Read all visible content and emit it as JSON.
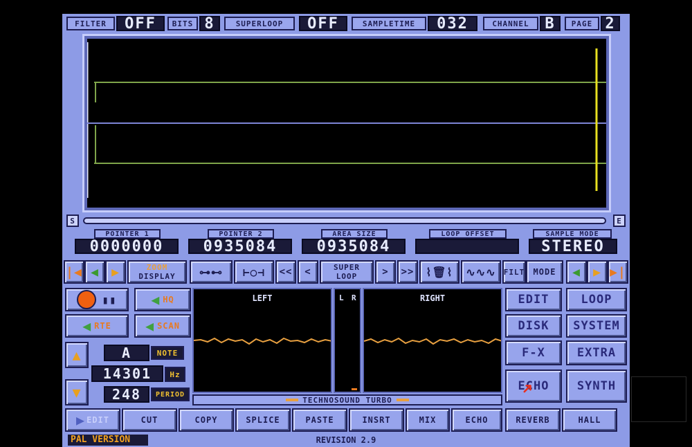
{
  "top_bar": {
    "filter_label": "FILTER",
    "filter_value": "OFF",
    "bits_label": "BITS",
    "bits_value": "8",
    "superloop_label": "SUPERLOOP",
    "superloop_value": "OFF",
    "sampletime_label": "SAMPLETIME",
    "sampletime_value": "032",
    "channel_label": "CHANNEL",
    "channel_value": "B",
    "page_label": "PAGE",
    "page_value": "2"
  },
  "scroll": {
    "start_label": "S",
    "end_label": "E"
  },
  "pointers": {
    "pointer1_label": "POINTER 1",
    "pointer1_value": "0000000",
    "pointer2_label": "POINTER 2",
    "pointer2_value": "0935084",
    "area_label": "AREA SIZE",
    "area_value": "0935084",
    "loop_label": "LOOP OFFSET",
    "loop_value": "",
    "mode_label": "SAMPLE MODE",
    "mode_value": "STEREO"
  },
  "toolbar": {
    "zoom_line1": "ZOOM",
    "zoom_line2": "DISPLAY",
    "rew_fast": "<<",
    "rew": "<",
    "superloop_line1": "SUPER",
    "superloop_line2": "LOOP",
    "fwd": ">",
    "fwd_fast": ">>",
    "filt": "FILT",
    "mode": "MODE"
  },
  "controls": {
    "hq_label": "HQ",
    "rte_label": "RTE",
    "scan_label": "SCAN",
    "note_value": "A",
    "note_label": "NOTE",
    "hz_value": "14301",
    "hz_label": "Hz",
    "period_value": "248",
    "period_label": "PERIOD"
  },
  "scopes": {
    "left_title": "LEFT",
    "right_title": "RIGHT",
    "l_label": "L",
    "r_label": "R",
    "banner": "TECHNOSOUND TURBO"
  },
  "menu": {
    "edit": "EDIT",
    "loop": "LOOP",
    "disk": "DISK",
    "system": "SYSTEM",
    "fx": "F-X",
    "extra": "EXTRA",
    "echo": "ECHO",
    "synth": "SYNTH"
  },
  "bottom": {
    "edit_label": "EDIT",
    "cut": "CUT",
    "copy": "COPY",
    "splice": "SPLICE",
    "paste": "PASTE",
    "insrt": "INSRT",
    "mix": "MIX",
    "echo": "ECHO",
    "reverb": "REVERB",
    "hall": "HALL"
  },
  "footer": {
    "pal": "PAL VERSION",
    "revision": "REVISION 2.9"
  },
  "colors": {
    "wave_green": "#7fa54a",
    "wave_blue": "#7e86d6",
    "marker_yellow": "#e8e020",
    "scope_orange": "#e8a040",
    "bg": "#8d9be6"
  }
}
